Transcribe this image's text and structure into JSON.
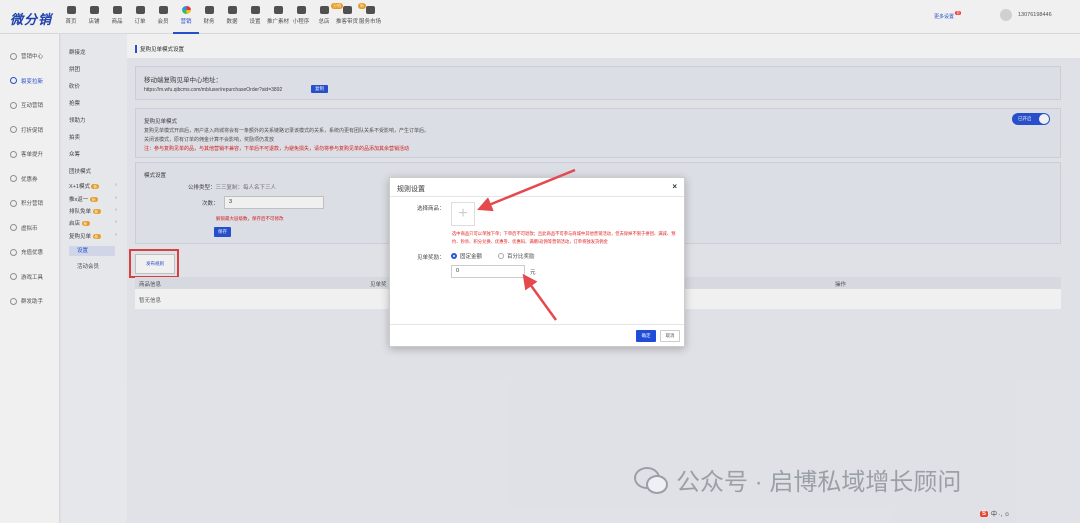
{
  "app": {
    "logo": "微分销"
  },
  "topnav": [
    {
      "label": "首页"
    },
    {
      "label": "店铺"
    },
    {
      "label": "商品"
    },
    {
      "label": "订单"
    },
    {
      "label": "会员"
    },
    {
      "label": "营销",
      "active": true
    },
    {
      "label": "财务"
    },
    {
      "label": "数据"
    },
    {
      "label": "设置"
    },
    {
      "label": "推广素材"
    },
    {
      "label": "小程序"
    },
    {
      "label": "总店",
      "badge": "分销"
    },
    {
      "label": "推客带货",
      "badge": "新"
    },
    {
      "label": "服务市场"
    }
  ],
  "topright": {
    "more": "更多设置",
    "more_badge": "新",
    "phone": "13076198446"
  },
  "sidebar": [
    {
      "label": "营销中心"
    },
    {
      "label": "裂变拉新",
      "active": true
    },
    {
      "label": "互动营销"
    },
    {
      "label": "打折促销"
    },
    {
      "label": "客单提升"
    },
    {
      "label": "优惠券"
    },
    {
      "label": "积分营销"
    },
    {
      "label": "虚拟币"
    },
    {
      "label": "充值优惠"
    },
    {
      "label": "游戏工具"
    },
    {
      "label": "群发助手"
    }
  ],
  "subsidebar": [
    {
      "label": "群接龙"
    },
    {
      "label": "拼团"
    },
    {
      "label": "砍价"
    },
    {
      "label": "抢票"
    },
    {
      "label": "领助力"
    },
    {
      "label": "拍卖"
    },
    {
      "label": "众筹"
    },
    {
      "label": "团扶模式"
    },
    {
      "label": "X+1模式",
      "tag": "新"
    },
    {
      "label": "推x返一",
      "tag": "新"
    },
    {
      "label": "排队免单",
      "tag": "新"
    },
    {
      "label": "启店",
      "tag": "新"
    },
    {
      "label": "复购见单",
      "tag": "新"
    },
    {
      "label": "设置",
      "selected": true
    },
    {
      "label": "活动会员"
    }
  ],
  "page": {
    "title": "复购见单模式设置",
    "link_title": "移动端复购见单中心地址：",
    "link_url": "https://m.wfu.qibcms.com/mb/user/repurchaseOrder?sid=3892",
    "copy": "复制",
    "mode_title": "复购见单模式",
    "mode_desc1": "复购见单模式开启后，用户进入商城将会有一条额外的关系链路记录该模式的关系，系统内更有团队关系不受影响，产生订单后。",
    "mode_desc2": "关闭该模式，原有订单的佣金计算不会影响，奖励项仍发放",
    "mode_warning": "注：参与复购见单的品，与其他营销不兼容，下单后不可退款，为避免损失，请勿将参与复购见单的品添加其余营销活动",
    "toggle": "已开启",
    "settings_title": "模式设置",
    "rule_type_label": "公排类型：",
    "rule_type_value": "三三复制：每人名下三人",
    "times_label": "次数：",
    "times_value": "3",
    "times_hint": "解锁最大层级数，保存后不可修改",
    "save": "保存",
    "publish": "发布规则",
    "table_headers": [
      "商品信息",
      "见单奖",
      "操作"
    ],
    "empty": "暂无信息"
  },
  "modal": {
    "title": "规则设置",
    "close": "×",
    "select_label": "选择商品：",
    "upload_plus": "+",
    "warning": "选中商品只可以单独下单；下单后不可退款；且此商品不可参与商城中其他营销活动，但去除掉不限于拼团、满减、预约、秒杀、积分兑换、优惠劵、优惠码、满赠/返佣等营销活动，订单将独发货佣金",
    "reward_label": "见单奖励：",
    "options": [
      "固定金额",
      "百分比奖励"
    ],
    "amount": "0",
    "unit": "元",
    "ok": "确定",
    "cancel": "取消"
  },
  "watermark": "公众号 · 启博私域增长顾问",
  "ime": {
    "s": "S",
    "text": "中 ·, ☺"
  }
}
